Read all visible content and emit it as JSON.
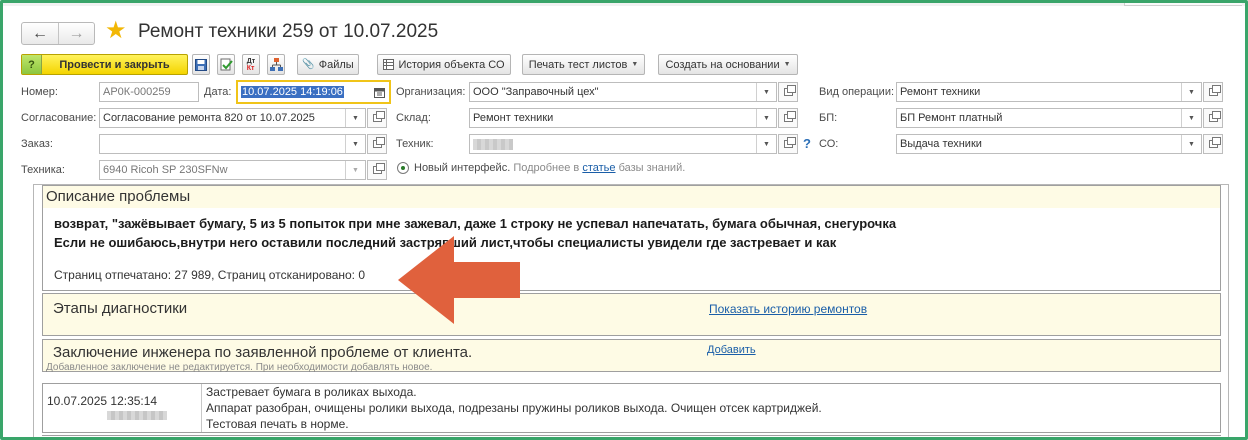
{
  "title": "Ремонт техники 259 от 10.07.2025",
  "nav": {
    "back": "←",
    "forward": "→"
  },
  "toolbar": {
    "help_mark": "?",
    "post_close": "Провести и закрыть",
    "files": "Файлы",
    "history": "История объекта СО",
    "print_test": "Печать тест листов",
    "create_based": "Создать на основании"
  },
  "form": {
    "number_label": "Номер:",
    "number_value": "АР0К-000259",
    "date_label": "Дата:",
    "date_value": "10.07.2025 14:19:06",
    "org_label": "Организация:",
    "org_value": "ООО \"Заправочный цех\"",
    "optype_label": "Вид операции:",
    "optype_value": "Ремонт техники",
    "approval_label": "Согласование:",
    "approval_value": "Согласование ремонта 820 от 10.07.2025",
    "warehouse_label": "Склад:",
    "warehouse_value": "Ремонт техники",
    "bp_label": "БП:",
    "bp_value": "БП Ремонт платный",
    "order_label": "Заказ:",
    "order_value": "",
    "tech_label": "Техник:",
    "tech_value": "",
    "co_label": "СО:",
    "co_value": "Выдача техники",
    "equipment_label": "Техника:",
    "equipment_value": "6940 Ricoh SP 230SFNw",
    "new_interface": "Новый интерфейс.",
    "more_in": "Подробнее в",
    "article": "статье",
    "knowledge_base": "базы знаний."
  },
  "problem": {
    "header": "Описание проблемы",
    "line1": "возврат, \"зажёвывает бумагу, 5 из 5 попыток при мне зажевал, даже 1 строку не успевал напечатать,  бумага обычная, снегурочка",
    "line2": "Если не ошибаюсь,внутри него оставили последний застрявший лист,чтобы специалисты увидели где застревает и как",
    "pages": "Страниц отпечатано: 27 989, Страниц отсканировано: 0"
  },
  "diagnostics": {
    "header": "Этапы диагностики",
    "history_link": "Показать историю ремонтов"
  },
  "conclusion": {
    "header": "Заключение инженера по заявленной проблеме от клиента.",
    "add_link": "Добавить",
    "hint": "Добавленное заключение не редактируется. При необходимости добавлять новое."
  },
  "records": [
    {
      "date": "10.07.2025 12:35:14",
      "lines": [
        "Застревает бумага в роликах выхода.",
        "Аппарат разобран, очищены ролики выхода, подрезаны пружины роликов выхода. Очищен отсек картриджей.",
        "Тестовая печать в норме."
      ]
    }
  ],
  "colors": {
    "frame": "#3aa56a",
    "arrow": "#e0613d",
    "primary": "#f4d400",
    "panel_header": "#fefbe5"
  }
}
